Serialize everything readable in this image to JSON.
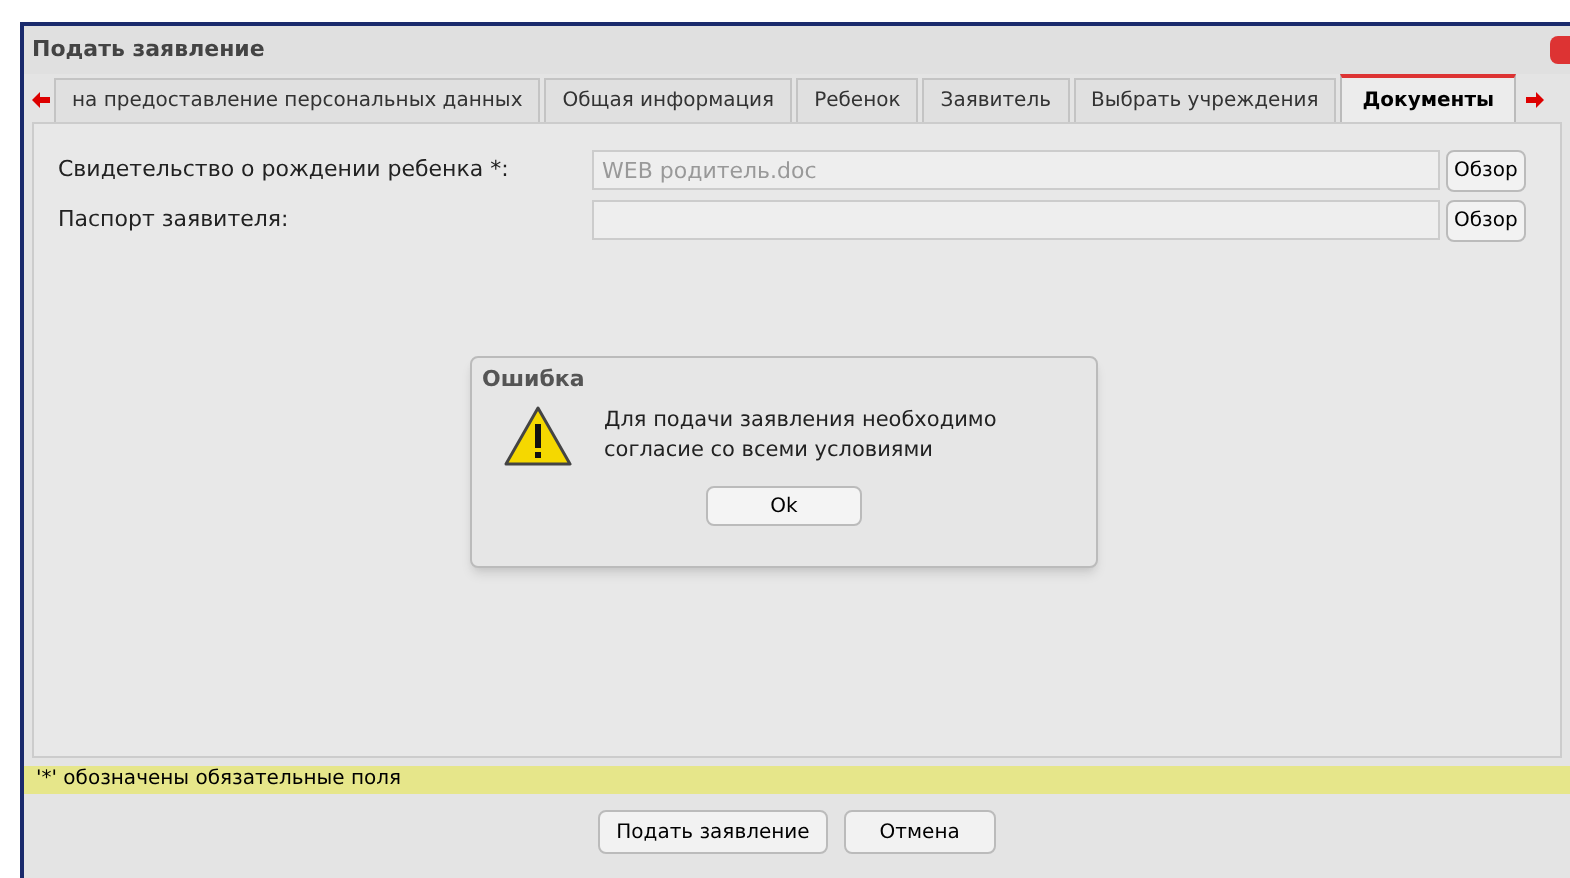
{
  "window": {
    "title": "Подать заявление"
  },
  "tabs": [
    {
      "label": "на предоставление персональных данных",
      "selected": false
    },
    {
      "label": "Общая информация",
      "selected": false
    },
    {
      "label": "Ребенок",
      "selected": false
    },
    {
      "label": "Заявитель",
      "selected": false
    },
    {
      "label": "Выбрать учреждения",
      "selected": false
    },
    {
      "label": "Документы",
      "selected": true
    }
  ],
  "fields": [
    {
      "label": "Свидетельство о рождении ребенка *:",
      "value": "WEB родитель.doc",
      "button": "Обзор"
    },
    {
      "label": "Паспорт заявителя:",
      "button": "Обзор"
    }
  ],
  "dialog": {
    "title": "Ошибка",
    "message": "Для подачи заявления необходимо согласие со всеми условиями",
    "button": "Ok"
  },
  "note": "'*' обозначены обязательные поля",
  "buttons": [
    "Подать заявление",
    "Отмена"
  ]
}
